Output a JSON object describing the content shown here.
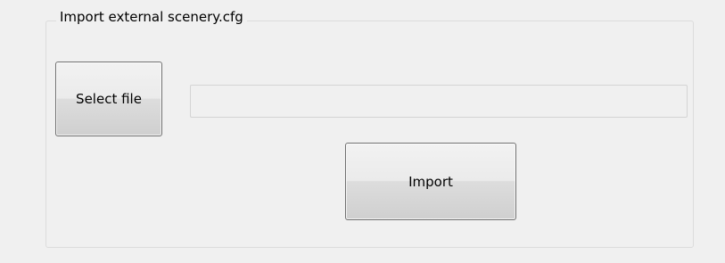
{
  "import_group": {
    "title": "Import external scenery.cfg",
    "select_file_label": "Select file",
    "file_path_value": "",
    "import_label": "Import"
  }
}
